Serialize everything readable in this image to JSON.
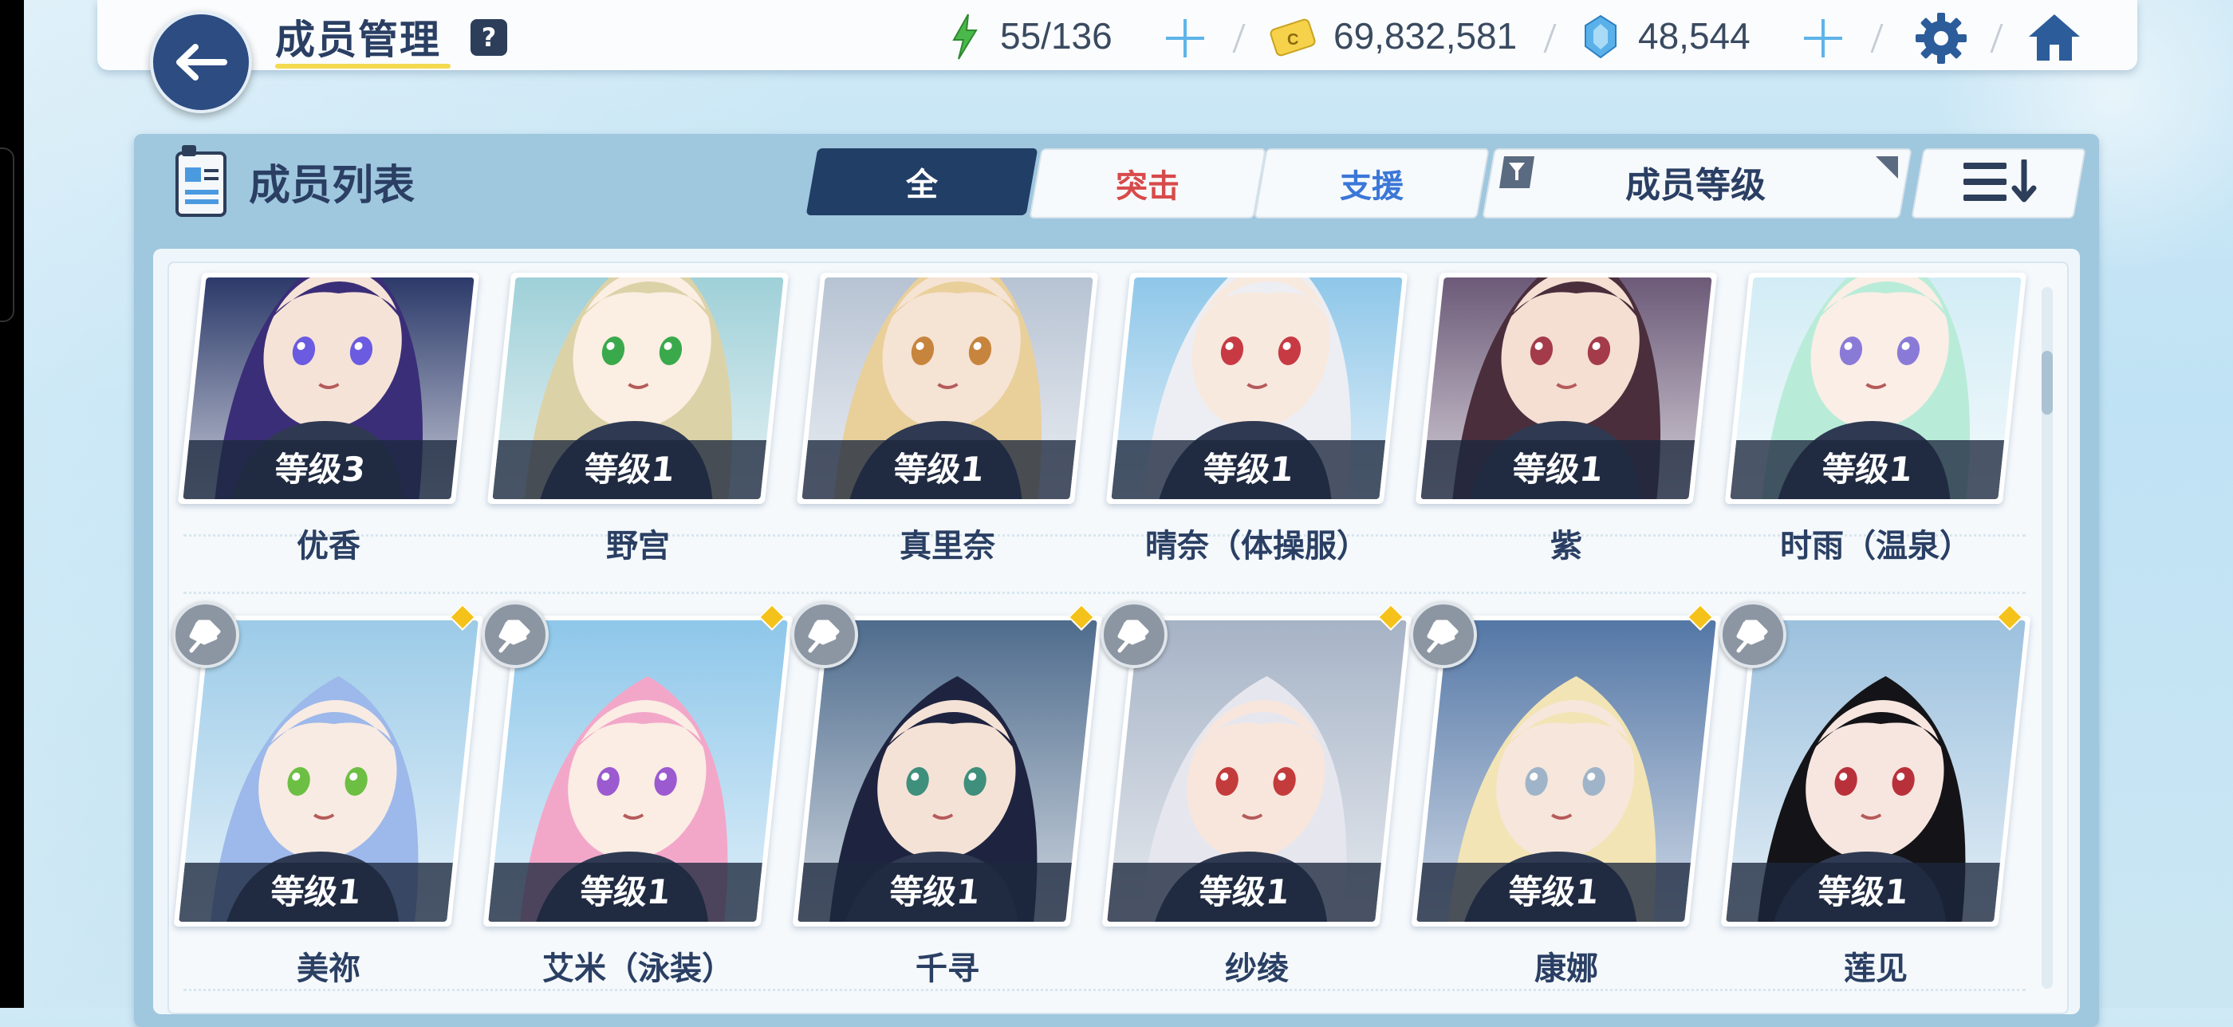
{
  "header": {
    "title": "成员管理",
    "help": "?",
    "stamina": "55/136",
    "credits": "69,832,581",
    "gems": "48,544"
  },
  "list": {
    "title": "成员列表",
    "tabs": [
      "全",
      "突击",
      "支援"
    ],
    "sort_label": "成员等级"
  },
  "members": [
    {
      "name": "优香",
      "level": "等级3",
      "hair": "#3b2e78",
      "bg": "#2c3a6a",
      "skin": "#f6e3d8",
      "eye": "#6a5be0"
    },
    {
      "name": "野宫",
      "level": "等级1",
      "hair": "#dcd2a8",
      "bg": "#9fd0d8",
      "skin": "#fbeee2",
      "eye": "#3aa94b"
    },
    {
      "name": "真里奈",
      "level": "等级1",
      "hair": "#e9cf9a",
      "bg": "#b7c3d3",
      "skin": "#f5e3d4",
      "eye": "#c7843c"
    },
    {
      "name": "晴奈（体操服）",
      "level": "等级1",
      "hair": "#eceef3",
      "bg": "#8fc7e9",
      "skin": "#f8e9df",
      "eye": "#c73a44"
    },
    {
      "name": "紫",
      "level": "等级1",
      "hair": "#4a2e3c",
      "bg": "#6c5a78",
      "skin": "#f4dfd2",
      "eye": "#a33b4a"
    },
    {
      "name": "时雨（温泉）",
      "level": "等级1",
      "hair": "#b9ecd8",
      "bg": "#d2ecf5",
      "skin": "#fbeee6",
      "eye": "#8a7ad8"
    },
    {
      "name": "美祢",
      "level": "等级1",
      "hair": "#9db8ea",
      "bg": "#9ccbe8",
      "skin": "#f8ebe3",
      "eye": "#6cbf43"
    },
    {
      "name": "艾米（泳装）",
      "level": "等级1",
      "hair": "#f2a7c9",
      "bg": "#8ec7ea",
      "skin": "#fbece4",
      "eye": "#9b5ad0"
    },
    {
      "name": "千寻",
      "level": "等级1",
      "hair": "#1e2440",
      "bg": "#4f6c8d",
      "skin": "#f5e2d6",
      "eye": "#3e8f7c"
    },
    {
      "name": "纱绫",
      "level": "等级1",
      "hair": "#e6e7ee",
      "bg": "#a6b3c6",
      "skin": "#f8e6dc",
      "eye": "#c43b3b"
    },
    {
      "name": "康娜",
      "level": "等级1",
      "hair": "#f2e4b4",
      "bg": "#5477a6",
      "skin": "#f6e6dc",
      "eye": "#9fb4c8"
    },
    {
      "name": "莲见",
      "level": "等级1",
      "hair": "#141418",
      "bg": "#9cc1de",
      "skin": "#f7e6df",
      "eye": "#b8313a"
    }
  ],
  "colors": {
    "accent_dark": "#213e66",
    "strike": "#d84a4a",
    "support": "#3b77d8",
    "stamina": "#4ab84a",
    "gem": "#5ab1ea"
  }
}
